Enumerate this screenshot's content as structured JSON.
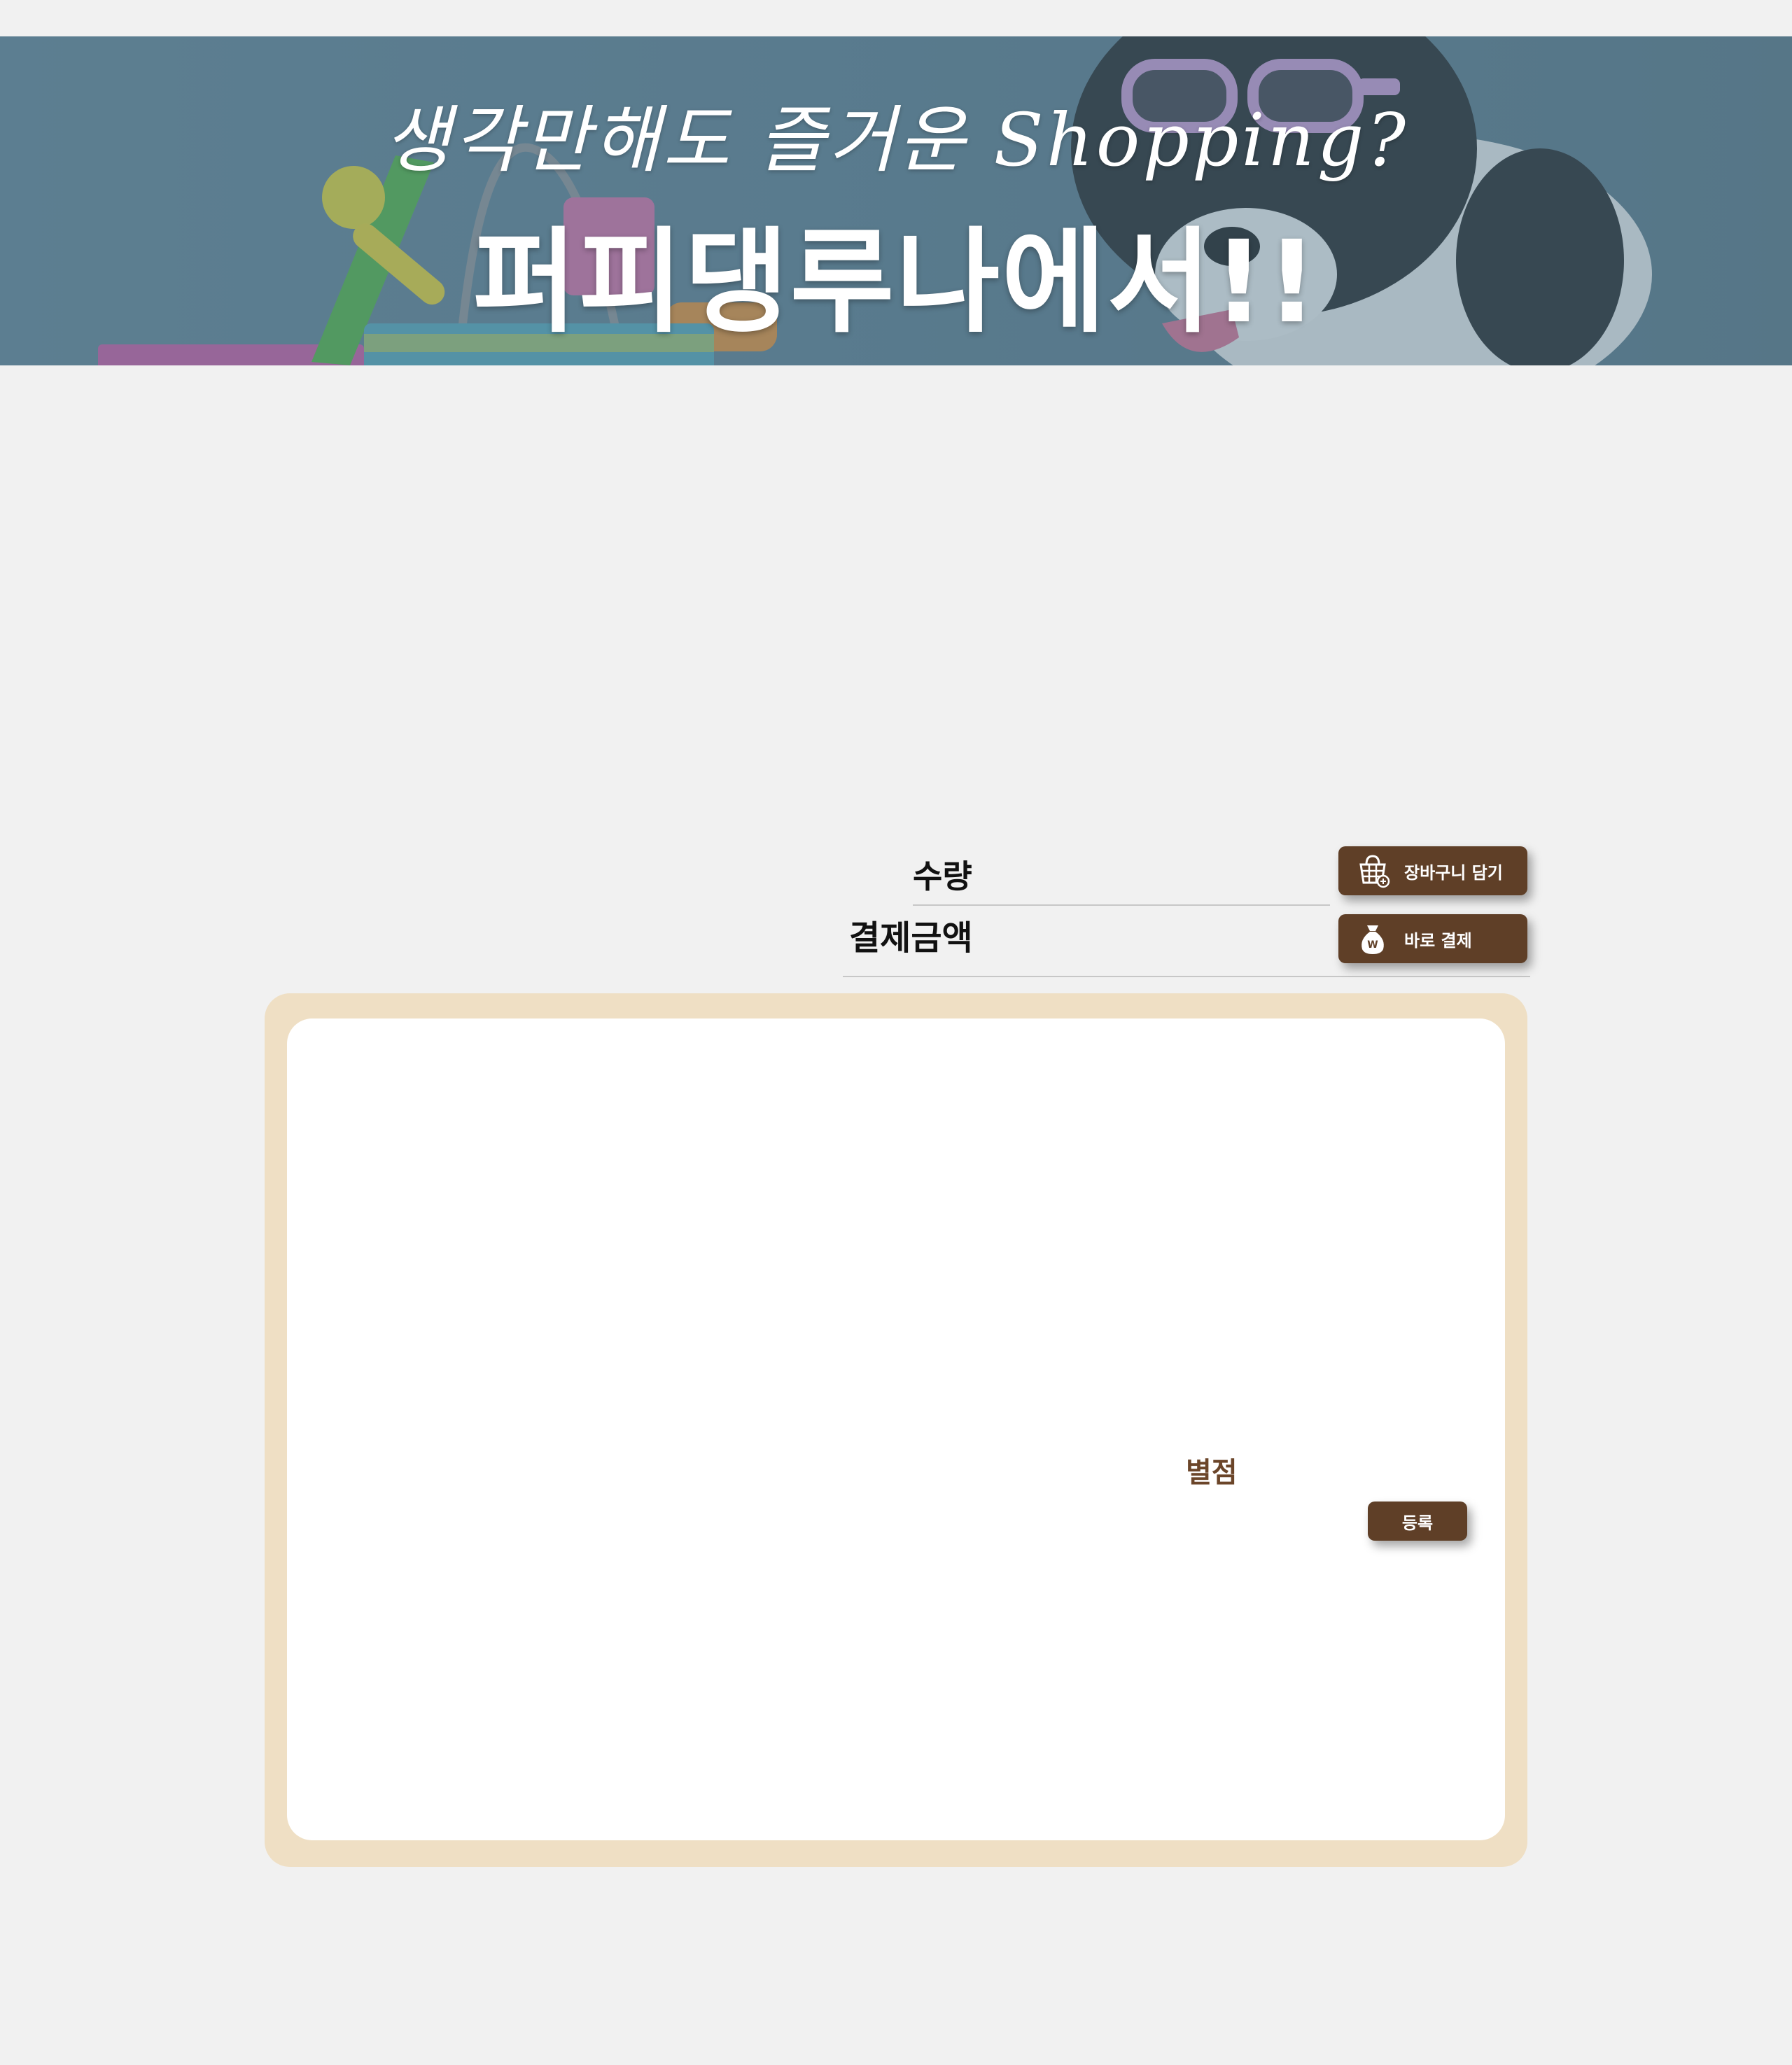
{
  "banner": {
    "tagline": "생각만해도 즐거운 Shopping?",
    "headline": "퍼피댕루나에서!!"
  },
  "purchase": {
    "quantity_label": "수량",
    "total_label": "결제금액",
    "add_to_cart_label": "장바구니 담기",
    "add_to_cart_icon": "shopping-basket-icon",
    "buy_now_label": "바로 결제",
    "buy_now_icon": "money-bag-icon",
    "money_bag_symbol": "W"
  },
  "review": {
    "rating_label": "별점",
    "register_label": "등록"
  },
  "colors": {
    "page_background": "#f1f1f1",
    "button_brown": "#5f3f27",
    "review_frame": "#efdfc4",
    "rating_text": "#6b4529"
  }
}
